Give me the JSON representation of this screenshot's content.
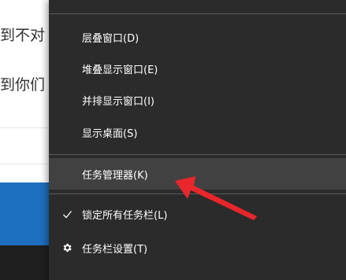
{
  "background": {
    "text_line_1": "到不对",
    "text_line_2": "到你们"
  },
  "menu": {
    "items": [
      {
        "label": "层叠窗口(D)"
      },
      {
        "label": "堆叠显示窗口(E)"
      },
      {
        "label": "并排显示窗口(I)"
      },
      {
        "label": "显示桌面(S)"
      },
      {
        "label": "任务管理器(K)"
      },
      {
        "label": "锁定所有任务栏(L)",
        "icon": "checkmark-icon"
      },
      {
        "label": "任务栏设置(T)",
        "icon": "gear-icon"
      }
    ]
  },
  "colors": {
    "menu_bg": "#2b2b2b",
    "highlight_bg": "#414141",
    "separator": "#5a5a5a",
    "arrow": "#e8262b"
  }
}
